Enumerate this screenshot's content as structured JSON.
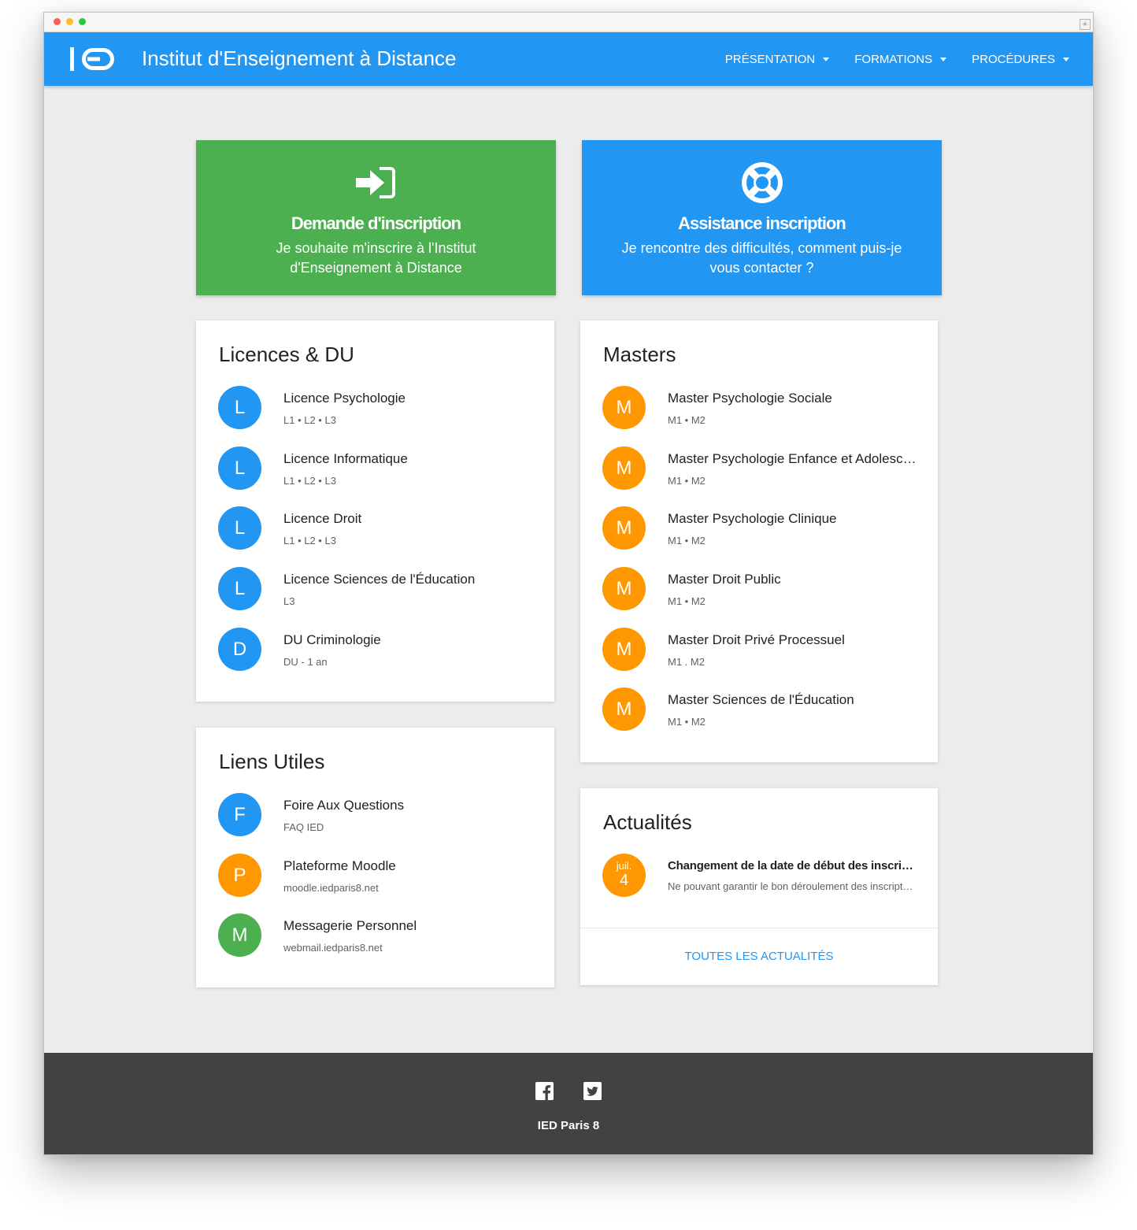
{
  "site": {
    "title": "Institut d'Enseignement à Distance",
    "logo_icon": "ied-logo",
    "nav": [
      {
        "label": "PRÉSENTATION"
      },
      {
        "label": "FORMATIONS"
      },
      {
        "label": "PROCÉDURES"
      }
    ]
  },
  "cta": {
    "register": {
      "title": "Demande d'inscription",
      "description": "Je souhaite m'inscrire à l'Institut d'Enseignement à Distance",
      "icon": "sign-in-icon",
      "color": "#4caf50"
    },
    "support": {
      "title": "Assistance inscription",
      "description": "Je rencontre des difficultés, comment puis-je vous contacter ?",
      "icon": "life-ring-icon",
      "color": "#2196f3"
    }
  },
  "licences": {
    "title": "Licences & DU",
    "items": [
      {
        "initial": "L",
        "title": "Licence Psychologie",
        "subtitle": "L1 • L2 • L3"
      },
      {
        "initial": "L",
        "title": "Licence Informatique",
        "subtitle": "L1 • L2 • L3"
      },
      {
        "initial": "L",
        "title": "Licence Droit",
        "subtitle": "L1 • L2 • L3"
      },
      {
        "initial": "L",
        "title": "Licence Sciences de l'Éducation",
        "subtitle": "L3"
      },
      {
        "initial": "D",
        "title": "DU Criminologie",
        "subtitle": "DU - 1 an"
      }
    ]
  },
  "masters": {
    "title": "Masters",
    "items": [
      {
        "initial": "M",
        "title": "Master Psychologie Sociale",
        "subtitle": "M1 • M2"
      },
      {
        "initial": "M",
        "title": "Master Psychologie Enfance et Adolescence",
        "subtitle": "M1 • M2"
      },
      {
        "initial": "M",
        "title": "Master Psychologie Clinique",
        "subtitle": "M1 • M2"
      },
      {
        "initial": "M",
        "title": "Master Droit Public",
        "subtitle": "M1 • M2"
      },
      {
        "initial": "M",
        "title": "Master Droit Privé Processuel",
        "subtitle": "M1 . M2"
      },
      {
        "initial": "M",
        "title": "Master Sciences de l'Éducation",
        "subtitle": "M1 • M2"
      }
    ]
  },
  "links": {
    "title": "Liens Utiles",
    "items": [
      {
        "initial": "F",
        "title": "Foire Aux Questions",
        "subtitle": "FAQ IED"
      },
      {
        "initial": "P",
        "title": "Plateforme Moodle",
        "subtitle": "moodle.iedparis8.net"
      },
      {
        "initial": "M",
        "title": "Messagerie Personnel",
        "subtitle": "webmail.iedparis8.net"
      }
    ]
  },
  "news": {
    "title": "Actualités",
    "item": {
      "month": "juil.",
      "day": "4",
      "title": "Changement de la date de début des inscriptions",
      "snippet": "Ne pouvant garantir le bon déroulement des inscriptions"
    },
    "all_label": "TOUTES LES ACTUALITÉS"
  },
  "footer": {
    "text": "IED Paris 8",
    "social": [
      "facebook-icon",
      "twitter-icon"
    ]
  },
  "colors": {
    "primary": "#2196f3",
    "success": "#4caf50",
    "accent": "#ff9800",
    "footer": "#424242"
  }
}
